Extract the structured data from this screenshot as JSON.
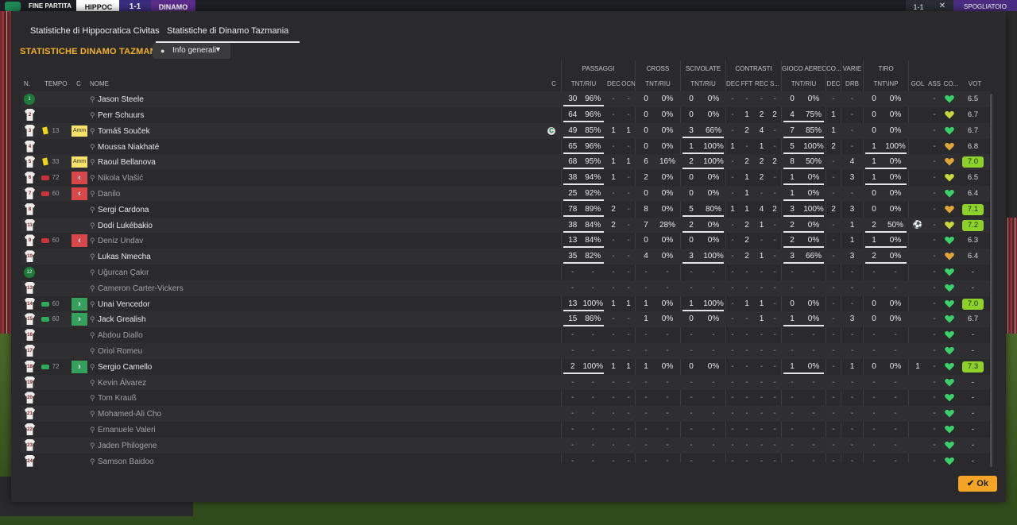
{
  "topbar": {
    "label": "FINE PARTITA",
    "home": "HIPPOC",
    "score": "1-1",
    "away": "DINAMO",
    "score_right": "1-1",
    "close": "✕",
    "right_btn": "SPOGLIATOIO"
  },
  "tabs": [
    {
      "label": "Statistiche di Hippocratica Civitas",
      "active": false
    },
    {
      "label": "Statistiche di Dinamo Tazmania",
      "active": true
    }
  ],
  "title": "STATISTICHE DINAMO TAZMANIA",
  "view_dropdown": {
    "value": "Info generali",
    "icon": "eye-icon"
  },
  "groups": [
    "PASSAGGI",
    "CROSS",
    "SCIVOLATE",
    "CONTRASTI",
    "GIOCO AEREO",
    "CO...",
    "VARIE",
    "TIRO"
  ],
  "columns": {
    "no": "N.",
    "time": "TEMPO",
    "c": "C",
    "name": "NOME",
    "cap": "C",
    "pass_tr": "TNT/RIU",
    "pass_dec": "DEC",
    "pass_ocn": "OCN",
    "cross_tr": "TNT/RIU",
    "tackle_tr": "TNT/RIU",
    "con_dec": "DEC",
    "con_fft": "FFT",
    "con_rec": "REC",
    "con_s": "S...",
    "air_tr": "TNT/RIU",
    "co_dec": "DEC",
    "drb": "DRB",
    "shot_ti": "TNT\\INP",
    "gol": "GOL",
    "ass": "ASS",
    "co": "CO...",
    "vot": "VOT"
  },
  "rows": [
    {
      "no": "1",
      "gk": true,
      "time": "",
      "amm": "",
      "sub": "",
      "name": "Jason Steele",
      "dim": false,
      "cap": "",
      "pt": "30",
      "pp": "96%",
      "pd": "-",
      "po": "-",
      "ct": "0",
      "cp": "0%",
      "st": "0",
      "sp": "0%",
      "c1": "-",
      "c2": "-",
      "c3": "-",
      "c4": "-",
      "at": "0",
      "ap": "0%",
      "cd": "-",
      "drb": "-",
      "tt": "0",
      "tp": "0%",
      "gol": "",
      "ass": "-",
      "heart": "green",
      "rating": "6.5",
      "hi": false
    },
    {
      "no": "2",
      "time": "",
      "amm": "",
      "sub": "",
      "name": "Perr Schuurs",
      "dim": false,
      "cap": "",
      "pt": "64",
      "pp": "96%",
      "pd": "-",
      "po": "-",
      "ct": "0",
      "cp": "0%",
      "st": "0",
      "sp": "0%",
      "c1": "-",
      "c2": "1",
      "c3": "2",
      "c4": "2",
      "at": "4",
      "ap": "75%",
      "cd": "1",
      "drb": "-",
      "tt": "0",
      "tp": "0%",
      "gol": "",
      "ass": "-",
      "heart": "yellow",
      "rating": "6.7",
      "hi": false
    },
    {
      "no": "3",
      "time": "13",
      "card": "yellow",
      "amm": "Amm",
      "sub": "",
      "name": "Tomáš Souček",
      "dim": false,
      "cap": "C",
      "pt": "49",
      "pp": "85%",
      "pd": "1",
      "po": "1",
      "ct": "0",
      "cp": "0%",
      "st": "3",
      "sp": "66%",
      "c1": "-",
      "c2": "2",
      "c3": "4",
      "c4": "-",
      "at": "7",
      "ap": "85%",
      "cd": "1",
      "drb": "-",
      "tt": "0",
      "tp": "0%",
      "gol": "",
      "ass": "-",
      "heart": "green",
      "rating": "6.7",
      "hi": false
    },
    {
      "no": "4",
      "time": "",
      "amm": "",
      "sub": "",
      "name": "Moussa Niakhaté",
      "dim": false,
      "cap": "",
      "pt": "65",
      "pp": "96%",
      "pd": "-",
      "po": "-",
      "ct": "0",
      "cp": "0%",
      "st": "1",
      "sp": "100%",
      "c1": "1",
      "c2": "-",
      "c3": "1",
      "c4": "-",
      "at": "5",
      "ap": "100%",
      "cd": "2",
      "drb": "-",
      "tt": "1",
      "tp": "100%",
      "gol": "",
      "ass": "-",
      "heart": "orange",
      "rating": "6.8",
      "hi": false
    },
    {
      "no": "5",
      "time": "33",
      "card": "yellow",
      "amm": "Amm",
      "sub": "",
      "name": "Raoul Bellanova",
      "dim": false,
      "cap": "",
      "pt": "68",
      "pp": "95%",
      "pd": "1",
      "po": "1",
      "ct": "6",
      "cp": "16%",
      "st": "2",
      "sp": "100%",
      "c1": "-",
      "c2": "2",
      "c3": "2",
      "c4": "2",
      "at": "8",
      "ap": "50%",
      "cd": "-",
      "drb": "4",
      "tt": "1",
      "tp": "0%",
      "gol": "",
      "ass": "-",
      "heart": "orange",
      "rating": "7.0",
      "hi": true
    },
    {
      "no": "6",
      "time": "72",
      "boot": "red",
      "amm": "",
      "sub": "out",
      "name": "Nikola Vlašić",
      "dim": true,
      "cap": "",
      "pt": "38",
      "pp": "94%",
      "pd": "1",
      "po": "-",
      "ct": "2",
      "cp": "0%",
      "st": "0",
      "sp": "0%",
      "c1": "-",
      "c2": "1",
      "c3": "2",
      "c4": "-",
      "at": "1",
      "ap": "0%",
      "cd": "-",
      "drb": "3",
      "tt": "1",
      "tp": "0%",
      "gol": "",
      "ass": "-",
      "heart": "yellow",
      "rating": "6.5",
      "hi": false
    },
    {
      "no": "7",
      "time": "60",
      "boot": "red",
      "amm": "",
      "sub": "out",
      "name": "Danilo",
      "dim": true,
      "cap": "",
      "pt": "25",
      "pp": "92%",
      "pd": "-",
      "po": "-",
      "ct": "0",
      "cp": "0%",
      "st": "0",
      "sp": "0%",
      "c1": "-",
      "c2": "1",
      "c3": "-",
      "c4": "-",
      "at": "1",
      "ap": "0%",
      "cd": "-",
      "drb": "-",
      "tt": "0",
      "tp": "0%",
      "gol": "",
      "ass": "-",
      "heart": "green",
      "rating": "6.4",
      "hi": false
    },
    {
      "no": "8",
      "time": "",
      "amm": "",
      "sub": "",
      "name": "Sergi Cardona",
      "dim": false,
      "cap": "",
      "pt": "78",
      "pp": "89%",
      "pd": "2",
      "po": "-",
      "ct": "8",
      "cp": "0%",
      "st": "5",
      "sp": "80%",
      "c1": "1",
      "c2": "1",
      "c3": "4",
      "c4": "2",
      "at": "3",
      "ap": "100%",
      "cd": "2",
      "drb": "3",
      "tt": "0",
      "tp": "0%",
      "gol": "",
      "ass": "-",
      "heart": "orange",
      "rating": "7.1",
      "hi": true
    },
    {
      "no": "11",
      "time": "",
      "amm": "",
      "sub": "",
      "name": "Dodi Lukébakio",
      "dim": false,
      "cap": "",
      "pt": "38",
      "pp": "84%",
      "pd": "2",
      "po": "-",
      "ct": "7",
      "cp": "28%",
      "st": "2",
      "sp": "0%",
      "c1": "-",
      "c2": "2",
      "c3": "1",
      "c4": "-",
      "at": "2",
      "ap": "0%",
      "cd": "-",
      "drb": "1",
      "tt": "2",
      "tp": "50%",
      "gol": "⚽",
      "ass": "-",
      "heart": "yellow",
      "rating": "7.2",
      "hi": true
    },
    {
      "no": "9",
      "time": "60",
      "boot": "red",
      "amm": "",
      "sub": "out",
      "name": "Deniz Undav",
      "dim": true,
      "cap": "",
      "pt": "13",
      "pp": "84%",
      "pd": "-",
      "po": "-",
      "ct": "0",
      "cp": "0%",
      "st": "0",
      "sp": "0%",
      "c1": "-",
      "c2": "2",
      "c3": "-",
      "c4": "-",
      "at": "2",
      "ap": "0%",
      "cd": "-",
      "drb": "1",
      "tt": "1",
      "tp": "0%",
      "gol": "",
      "ass": "-",
      "heart": "green",
      "rating": "6.3",
      "hi": false
    },
    {
      "no": "10",
      "time": "",
      "amm": "",
      "sub": "",
      "name": "Lukas Nmecha",
      "dim": false,
      "cap": "",
      "pt": "35",
      "pp": "82%",
      "pd": "-",
      "po": "-",
      "ct": "4",
      "cp": "0%",
      "st": "3",
      "sp": "100%",
      "c1": "-",
      "c2": "2",
      "c3": "1",
      "c4": "-",
      "at": "3",
      "ap": "66%",
      "cd": "-",
      "drb": "3",
      "tt": "2",
      "tp": "0%",
      "gol": "",
      "ass": "-",
      "heart": "orange",
      "rating": "6.4",
      "hi": false
    },
    {
      "no": "12",
      "gk": true,
      "time": "",
      "amm": "",
      "sub": "",
      "name": "Uğurcan Çakır",
      "dim": true,
      "cap": "",
      "pt": "-",
      "pp": "-",
      "pd": "-",
      "po": "-",
      "ct": "-",
      "cp": "-",
      "st": "-",
      "sp": "-",
      "c1": "-",
      "c2": "-",
      "c3": "-",
      "c4": "-",
      "at": "-",
      "ap": "-",
      "cd": "-",
      "drb": "-",
      "tt": "-",
      "tp": "-",
      "gol": "",
      "ass": "-",
      "heart": "green",
      "rating": "-",
      "hi": false
    },
    {
      "no": "13",
      "time": "",
      "amm": "",
      "sub": "",
      "name": "Cameron Carter-Vickers",
      "dim": true,
      "cap": "",
      "pt": "-",
      "pp": "-",
      "pd": "-",
      "po": "-",
      "ct": "-",
      "cp": "-",
      "st": "-",
      "sp": "-",
      "c1": "-",
      "c2": "-",
      "c3": "-",
      "c4": "-",
      "at": "-",
      "ap": "-",
      "cd": "-",
      "drb": "-",
      "tt": "-",
      "tp": "-",
      "gol": "",
      "ass": "-",
      "heart": "green",
      "rating": "-",
      "hi": false
    },
    {
      "no": "14",
      "time": "60",
      "boot": "green",
      "amm": "",
      "sub": "in",
      "name": "Unai Vencedor",
      "dim": false,
      "cap": "",
      "pt": "13",
      "pp": "100%",
      "pd": "1",
      "po": "1",
      "ct": "1",
      "cp": "0%",
      "st": "1",
      "sp": "100%",
      "c1": "-",
      "c2": "1",
      "c3": "1",
      "c4": "-",
      "at": "0",
      "ap": "0%",
      "cd": "-",
      "drb": "-",
      "tt": "0",
      "tp": "0%",
      "gol": "",
      "ass": "-",
      "heart": "green",
      "rating": "7.0",
      "hi": true
    },
    {
      "no": "15",
      "time": "60",
      "boot": "green",
      "amm": "",
      "sub": "in",
      "name": "Jack Grealish",
      "dim": false,
      "cap": "",
      "pt": "15",
      "pp": "86%",
      "pd": "-",
      "po": "-",
      "ct": "1",
      "cp": "0%",
      "st": "0",
      "sp": "0%",
      "c1": "-",
      "c2": "-",
      "c3": "1",
      "c4": "-",
      "at": "1",
      "ap": "0%",
      "cd": "-",
      "drb": "3",
      "tt": "0",
      "tp": "0%",
      "gol": "",
      "ass": "-",
      "heart": "green",
      "rating": "6.7",
      "hi": false
    },
    {
      "no": "16",
      "time": "",
      "amm": "",
      "sub": "",
      "name": "Abdou Diallo",
      "dim": true,
      "cap": "",
      "pt": "-",
      "pp": "-",
      "pd": "-",
      "po": "-",
      "ct": "-",
      "cp": "-",
      "st": "-",
      "sp": "-",
      "c1": "-",
      "c2": "-",
      "c3": "-",
      "c4": "-",
      "at": "-",
      "ap": "-",
      "cd": "-",
      "drb": "-",
      "tt": "-",
      "tp": "-",
      "gol": "",
      "ass": "-",
      "heart": "green",
      "rating": "-",
      "hi": false
    },
    {
      "no": "17",
      "time": "",
      "amm": "",
      "sub": "",
      "name": "Oriol Romeu",
      "dim": true,
      "cap": "",
      "pt": "-",
      "pp": "-",
      "pd": "-",
      "po": "-",
      "ct": "-",
      "cp": "-",
      "st": "-",
      "sp": "-",
      "c1": "-",
      "c2": "-",
      "c3": "-",
      "c4": "-",
      "at": "-",
      "ap": "-",
      "cd": "-",
      "drb": "-",
      "tt": "-",
      "tp": "-",
      "gol": "",
      "ass": "-",
      "heart": "green",
      "rating": "-",
      "hi": false
    },
    {
      "no": "18",
      "time": "72",
      "boot": "green",
      "amm": "",
      "sub": "in",
      "name": "Sergio Camello",
      "dim": false,
      "cap": "",
      "pt": "2",
      "pp": "100%",
      "pd": "1",
      "po": "1",
      "ct": "1",
      "cp": "0%",
      "st": "0",
      "sp": "0%",
      "c1": "-",
      "c2": "-",
      "c3": "-",
      "c4": "-",
      "at": "1",
      "ap": "0%",
      "cd": "-",
      "drb": "1",
      "tt": "0",
      "tp": "0%",
      "gol": "1",
      "ass": "-",
      "heart": "green",
      "rating": "7.3",
      "hi": true
    },
    {
      "no": "19",
      "time": "",
      "amm": "",
      "sub": "",
      "name": "Kevin Álvarez",
      "dim": true,
      "cap": "",
      "pt": "-",
      "pp": "-",
      "pd": "-",
      "po": "-",
      "ct": "-",
      "cp": "-",
      "st": "-",
      "sp": "-",
      "c1": "-",
      "c2": "-",
      "c3": "-",
      "c4": "-",
      "at": "-",
      "ap": "-",
      "cd": "-",
      "drb": "-",
      "tt": "-",
      "tp": "-",
      "gol": "",
      "ass": "-",
      "heart": "green",
      "rating": "-",
      "hi": false
    },
    {
      "no": "20",
      "time": "",
      "amm": "",
      "sub": "",
      "name": "Tom Krauß",
      "dim": true,
      "cap": "",
      "pt": "-",
      "pp": "-",
      "pd": "-",
      "po": "-",
      "ct": "-",
      "cp": "-",
      "st": "-",
      "sp": "-",
      "c1": "-",
      "c2": "-",
      "c3": "-",
      "c4": "-",
      "at": "-",
      "ap": "-",
      "cd": "-",
      "drb": "-",
      "tt": "-",
      "tp": "-",
      "gol": "",
      "ass": "-",
      "heart": "green",
      "rating": "-",
      "hi": false
    },
    {
      "no": "21",
      "time": "",
      "amm": "",
      "sub": "",
      "name": "Mohamed-Ali Cho",
      "dim": true,
      "cap": "",
      "pt": "-",
      "pp": "-",
      "pd": "-",
      "po": "-",
      "ct": "-",
      "cp": "-",
      "st": "-",
      "sp": "-",
      "c1": "-",
      "c2": "-",
      "c3": "-",
      "c4": "-",
      "at": "-",
      "ap": "-",
      "cd": "-",
      "drb": "-",
      "tt": "-",
      "tp": "-",
      "gol": "",
      "ass": "-",
      "heart": "green",
      "rating": "-",
      "hi": false
    },
    {
      "no": "22",
      "time": "",
      "amm": "",
      "sub": "",
      "name": "Emanuele Valeri",
      "dim": true,
      "cap": "",
      "pt": "-",
      "pp": "-",
      "pd": "-",
      "po": "-",
      "ct": "-",
      "cp": "-",
      "st": "-",
      "sp": "-",
      "c1": "-",
      "c2": "-",
      "c3": "-",
      "c4": "-",
      "at": "-",
      "ap": "-",
      "cd": "-",
      "drb": "-",
      "tt": "-",
      "tp": "-",
      "gol": "",
      "ass": "-",
      "heart": "green",
      "rating": "-",
      "hi": false
    },
    {
      "no": "23",
      "time": "",
      "amm": "",
      "sub": "",
      "name": "Jaden Philogene",
      "dim": true,
      "cap": "",
      "pt": "-",
      "pp": "-",
      "pd": "-",
      "po": "-",
      "ct": "-",
      "cp": "-",
      "st": "-",
      "sp": "-",
      "c1": "-",
      "c2": "-",
      "c3": "-",
      "c4": "-",
      "at": "-",
      "ap": "-",
      "cd": "-",
      "drb": "-",
      "tt": "-",
      "tp": "-",
      "gol": "",
      "ass": "-",
      "heart": "green",
      "rating": "-",
      "hi": false
    },
    {
      "no": "24",
      "time": "",
      "amm": "",
      "sub": "",
      "name": "Samson Baidoo",
      "dim": true,
      "cap": "",
      "pt": "-",
      "pp": "-",
      "pd": "-",
      "po": "-",
      "ct": "-",
      "cp": "-",
      "st": "-",
      "sp": "-",
      "c1": "-",
      "c2": "-",
      "c3": "-",
      "c4": "-",
      "at": "-",
      "ap": "-",
      "cd": "-",
      "drb": "-",
      "tt": "-",
      "tp": "-",
      "gol": "",
      "ass": "-",
      "heart": "green",
      "rating": "-",
      "hi": false
    }
  ],
  "ok_label": "Ok",
  "colors": {
    "accent": "#f4b225",
    "ok": "#f4a525",
    "rating_hi": "#8fd12b",
    "heart_green": "#3ad06a",
    "heart_yellow": "#c8d83a",
    "heart_orange": "#e0a43a"
  }
}
